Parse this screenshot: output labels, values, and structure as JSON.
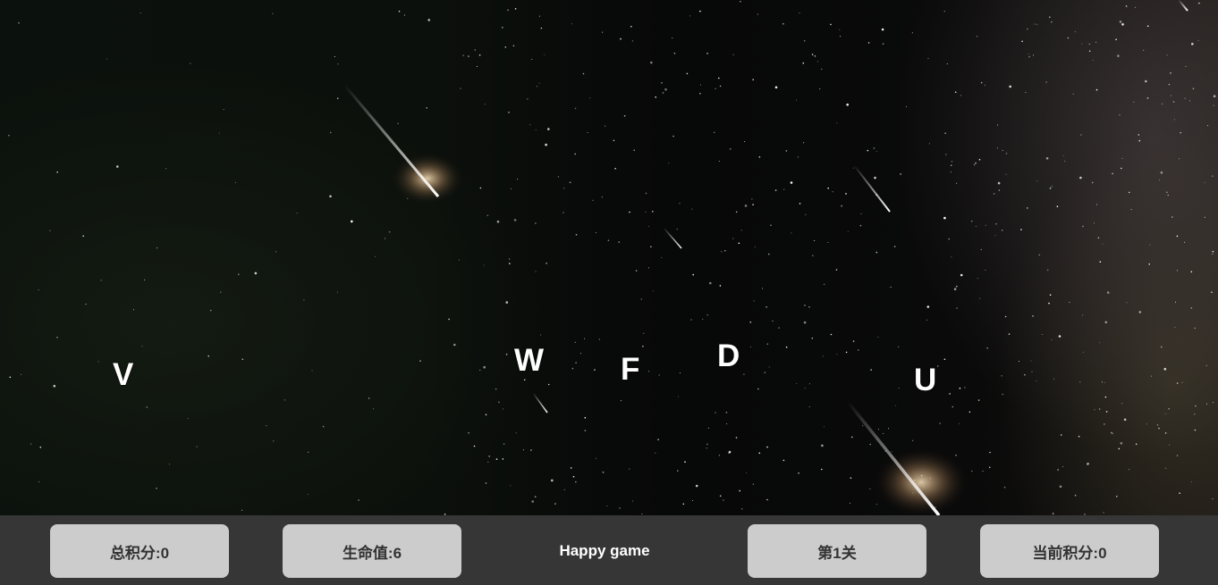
{
  "game": {
    "falling_letters": [
      "V",
      "W",
      "F",
      "D",
      "U"
    ],
    "palette": {
      "status_bar": "#363636",
      "button": "#cccccc",
      "button_text": "#333333",
      "title_text": "#ffffff",
      "letter": "#ffffff",
      "meteor": "#fff6e0"
    }
  },
  "status_bar": {
    "total_score": "总积分:0",
    "lives": "生命值:6",
    "title": "Happy game",
    "level": "第1关",
    "current_score": "当前积分:0"
  }
}
